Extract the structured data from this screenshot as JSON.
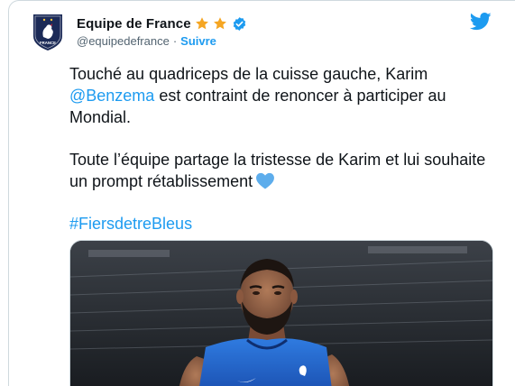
{
  "tweet": {
    "display_name": "Equipe de France",
    "handle": "@equipedefrance",
    "separator": "·",
    "follow_label": "Suivre",
    "text": {
      "para1_before": "Touché au quadriceps de la cuisse gauche, Karim ",
      "mention": "@Benzema",
      "para1_after": " est contraint de renoncer à participer au Mondial.",
      "para2": "Toute l’équipe partage la tristesse de Karim et lui souhaite un prompt rétablissement",
      "hashtag": "#FiersdetreBleus"
    },
    "avatar_text": "FRANCE",
    "icons": {
      "stars": [
        "star-icon",
        "star-icon"
      ],
      "verified": "verified-badge-icon",
      "platform": "twitter-bird-icon",
      "heart": "blue-heart-emoji-icon"
    },
    "colors": {
      "accent": "#1d9bf0",
      "text": "#0f1419",
      "muted": "#536471",
      "star": "#f5a623",
      "heart": "#5dadec",
      "avatar_bg": "#1b2a57"
    },
    "media": {
      "description_icon": "player-photo"
    }
  }
}
